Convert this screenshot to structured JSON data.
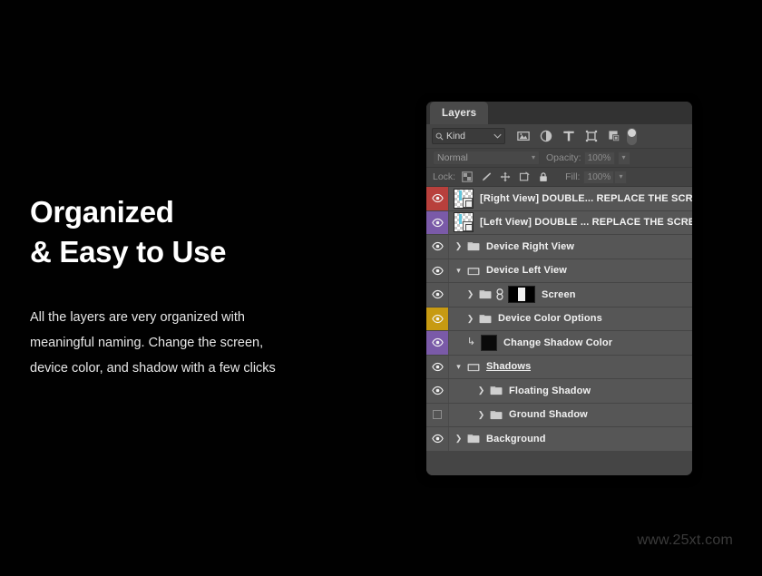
{
  "promo": {
    "headline_line1": "Organized",
    "headline_line2": "& Easy to Use",
    "body_line1": "All the layers are very organized with",
    "body_line2": "meaningful naming. Change the screen,",
    "body_line3": "device color, and shadow with a few clicks",
    "watermark": "www.25xt.com"
  },
  "colors": {
    "canvas_background": "#010101",
    "panel_background": "#3b3b3b",
    "row_background": "#565656",
    "label_red": "#b8403c",
    "label_violet": "#7a5aa8",
    "label_yellow": "#c79a12",
    "label_none": "#545454",
    "text_primary": "#f2f2f2",
    "text_dim": "#8e8e8e",
    "thumb_accent": "#62c6dd"
  },
  "panel": {
    "tab_label": "Layers",
    "filter": {
      "kind_label": "Kind",
      "search_icon": "search-icon",
      "caret_icon": "chevron-down-icon",
      "filter_icons": [
        {
          "name": "pixel-layer-filter-icon",
          "title": "Filter for pixel layers"
        },
        {
          "name": "adjustment-layer-filter-icon",
          "title": "Filter for adjustment layers"
        },
        {
          "name": "type-layer-filter-icon",
          "title": "Filter for type layers"
        },
        {
          "name": "shape-layer-filter-icon",
          "title": "Filter for shape layers"
        },
        {
          "name": "smart-object-filter-icon",
          "title": "Filter for smart objects"
        }
      ],
      "toggle_name": "filter-enable-toggle"
    },
    "blend": {
      "mode_value": "Normal",
      "opacity_label": "Opacity:",
      "opacity_value": "100%"
    },
    "lock": {
      "lock_label": "Lock:",
      "fill_label": "Fill:",
      "fill_value": "100%",
      "lock_icons": [
        {
          "name": "lock-transparent-pixels-icon"
        },
        {
          "name": "lock-image-pixels-icon"
        },
        {
          "name": "lock-position-icon"
        },
        {
          "name": "lock-artboard-nesting-icon"
        },
        {
          "name": "lock-all-icon"
        }
      ]
    },
    "layers": [
      {
        "name": "[Right View] DOUBLE... REPLACE THE SCREEN",
        "label_color": "#b8403c",
        "visible": true,
        "indent": 0,
        "kind": "smart-object",
        "expandable": false,
        "underline": false
      },
      {
        "name": "[Left View] DOUBLE ... REPLACE THE SCREEN",
        "label_color": "#7a5aa8",
        "visible": true,
        "indent": 0,
        "kind": "smart-object",
        "expandable": false,
        "underline": false
      },
      {
        "name": "Device Right View",
        "label_color": "#545454",
        "visible": true,
        "indent": 0,
        "kind": "group",
        "expandable": true,
        "expanded": false,
        "underline": false
      },
      {
        "name": "Device Left View",
        "label_color": "#545454",
        "visible": true,
        "indent": 0,
        "kind": "group",
        "expandable": true,
        "expanded": true,
        "underline": false
      },
      {
        "name": "Screen",
        "label_color": "#545454",
        "visible": true,
        "indent": 1,
        "kind": "group-masked",
        "expandable": true,
        "expanded": false,
        "underline": false
      },
      {
        "name": "Device Color Options",
        "label_color": "#c79a12",
        "visible": true,
        "indent": 1,
        "kind": "group",
        "expandable": true,
        "expanded": false,
        "underline": false
      },
      {
        "name": "Change Shadow Color",
        "label_color": "#7a5aa8",
        "visible": true,
        "indent": 1,
        "kind": "clipped-fill",
        "expandable": false,
        "underline": false
      },
      {
        "name": "Shadows",
        "label_color": "#545454",
        "visible": true,
        "indent": 0,
        "kind": "group",
        "expandable": true,
        "expanded": true,
        "underline": true
      },
      {
        "name": "Floating Shadow",
        "label_color": "#545454",
        "visible": true,
        "indent": 2,
        "kind": "group",
        "expandable": true,
        "expanded": false,
        "underline": false
      },
      {
        "name": "Ground Shadow",
        "label_color": "#545454",
        "visible": false,
        "indent": 2,
        "kind": "group",
        "expandable": true,
        "expanded": false,
        "underline": false
      },
      {
        "name": "Background",
        "label_color": "#545454",
        "visible": true,
        "indent": 0,
        "kind": "group",
        "expandable": true,
        "expanded": false,
        "underline": false
      }
    ]
  }
}
